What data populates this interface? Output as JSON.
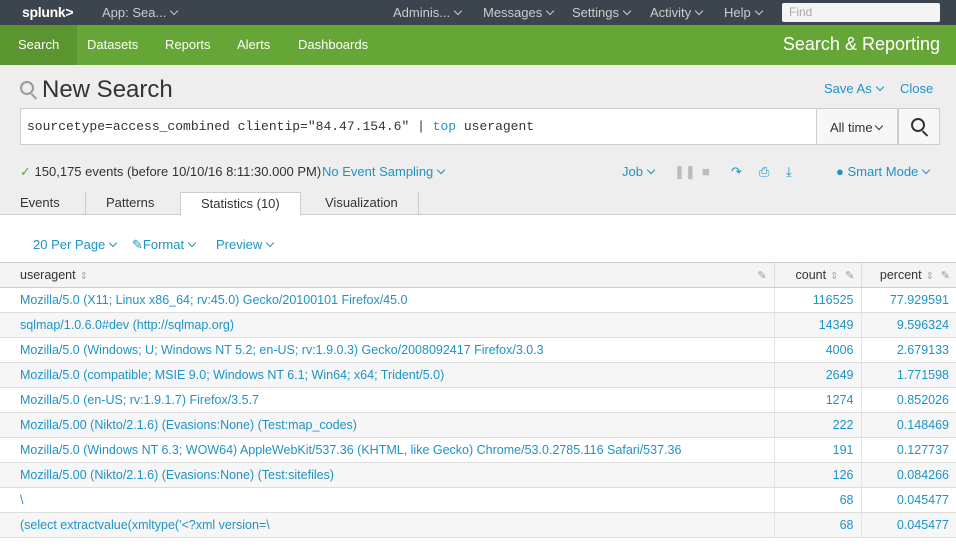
{
  "topbar": {
    "logo": "splunk>",
    "app": "App: Sea...",
    "menus": [
      "Adminis...",
      "Messages",
      "Settings",
      "Activity",
      "Help"
    ],
    "find_placeholder": "Find"
  },
  "appbar": {
    "nav": [
      "Search",
      "Datasets",
      "Reports",
      "Alerts",
      "Dashboards"
    ],
    "title": "Search & Reporting"
  },
  "search": {
    "title": "New Search",
    "save_as": "Save As",
    "close": "Close",
    "query_prefix": "sourcetype=access_combined clientip=\"84.47.154.6\" | ",
    "query_command": "top",
    "query_suffix": " useragent",
    "time_range": "All time"
  },
  "status": {
    "events": "150,175 events (before 10/10/16 8:11:30.000 PM)",
    "sampling": "No Event Sampling",
    "job": "Job",
    "mode": "Smart Mode"
  },
  "tabs": [
    "Events",
    "Patterns",
    "Statistics (10)",
    "Visualization"
  ],
  "controls": {
    "per_page": "20 Per Page",
    "format": "Format",
    "preview": "Preview"
  },
  "table": {
    "headers": [
      "useragent",
      "count",
      "percent"
    ],
    "rows": [
      [
        "Mozilla/5.0 (X11; Linux x86_64; rv:45.0) Gecko/20100101 Firefox/45.0",
        "116525",
        "77.929591"
      ],
      [
        "sqlmap/1.0.6.0#dev (http://sqlmap.org)",
        "14349",
        "9.596324"
      ],
      [
        "Mozilla/5.0 (Windows; U; Windows NT 5.2; en-US; rv:1.9.0.3) Gecko/2008092417 Firefox/3.0.3",
        "4006",
        "2.679133"
      ],
      [
        "Mozilla/5.0 (compatible; MSIE 9.0; Windows NT 6.1; Win64; x64; Trident/5.0)",
        "2649",
        "1.771598"
      ],
      [
        "Mozilla/5.0 (en-US; rv:1.9.1.7) Firefox/3.5.7",
        "1274",
        "0.852026"
      ],
      [
        "Mozilla/5.00 (Nikto/2.1.6) (Evasions:None) (Test:map_codes)",
        "222",
        "0.148469"
      ],
      [
        "Mozilla/5.0 (Windows NT 6.3; WOW64) AppleWebKit/537.36 (KHTML, like Gecko) Chrome/53.0.2785.116 Safari/537.36",
        "191",
        "0.127737"
      ],
      [
        "Mozilla/5.00 (Nikto/2.1.6) (Evasions:None) (Test:sitefiles)",
        "126",
        "0.084266"
      ],
      [
        "\\",
        "68",
        "0.045477"
      ],
      [
        "(select extractvalue(xmltype('<?xml version=\\",
        "68",
        "0.045477"
      ]
    ]
  },
  "colors": {
    "topbar": "#3c444d",
    "appbar": "#65a637",
    "link": "#1e93c6"
  }
}
